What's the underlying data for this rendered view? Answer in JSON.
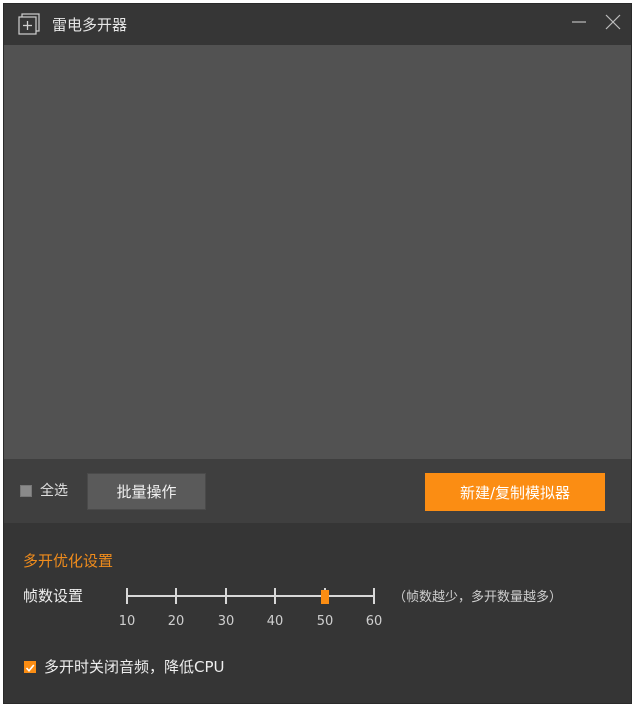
{
  "window": {
    "title": "雷电多开器"
  },
  "toolbar": {
    "select_all_label": "全选",
    "batch_button": "批量操作",
    "new_button": "新建/复制模拟器"
  },
  "settings": {
    "section_title": "多开优化设置",
    "fps_label": "帧数设置",
    "fps_ticks": [
      "10",
      "20",
      "30",
      "40",
      "50",
      "60"
    ],
    "fps_value": 50,
    "fps_hint": "（帧数越少，多开数量越多）",
    "audio_checkbox_label": "多开时关闭音频，降低CPU",
    "audio_checked": true
  },
  "colors": {
    "accent": "#fb8d13",
    "title_accent": "#f08c1c"
  }
}
